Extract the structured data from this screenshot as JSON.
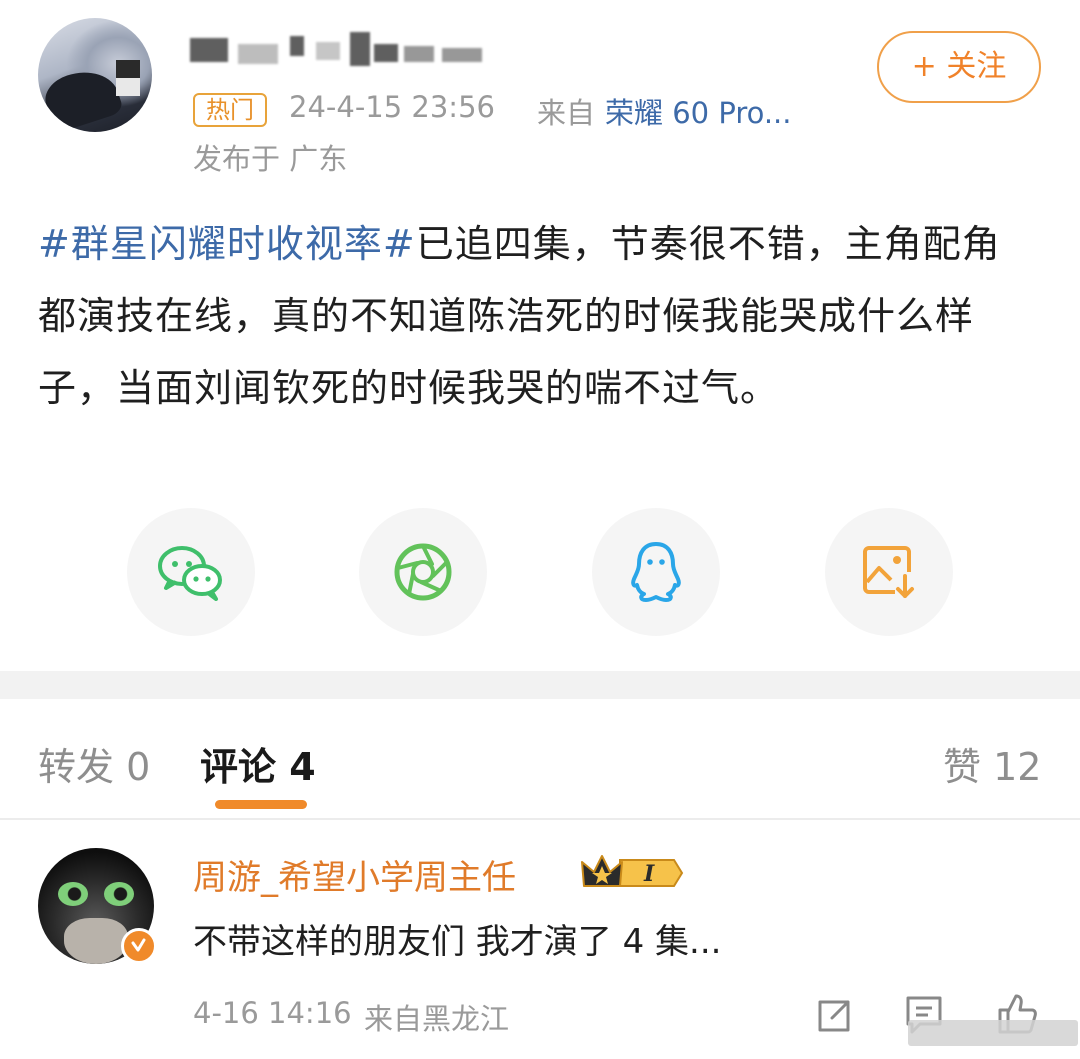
{
  "post": {
    "hot_badge": "热门",
    "time": "24-4-15 23:56",
    "source_prefix": "来自",
    "device": "荣耀 60 Pro...",
    "location": "发布于 广东",
    "follow_label": "+ 关注",
    "hashtag": "#群星闪耀时收视率#",
    "text": "已追四集，节奏很不错，主角配角都演技在线，真的不知道陈浩死的时候我能哭成什么样子，当面刘闻钦死的时候我哭的喘不过气。"
  },
  "share": {
    "items": [
      {
        "icon": "wechat-icon",
        "color": "#3fbf6b"
      },
      {
        "icon": "moments-icon",
        "color": "#62c25a"
      },
      {
        "icon": "qq-icon",
        "color": "#2aa6e8"
      },
      {
        "icon": "save-image-icon",
        "color": "#f2a33a"
      }
    ]
  },
  "tabs": {
    "repost": "转发 0",
    "comments": "评论 4",
    "likes": "赞 12"
  },
  "comment": {
    "author": "周游_希望小学周主任",
    "vip_level": "I",
    "text": "不带这样的朋友们 我才演了 4 集...",
    "time": "4-16 14:16",
    "source": "来自黑龙江"
  },
  "colors": {
    "accent": "#f08a2a",
    "link": "#3d6aa8",
    "muted": "#9a9a9a"
  }
}
